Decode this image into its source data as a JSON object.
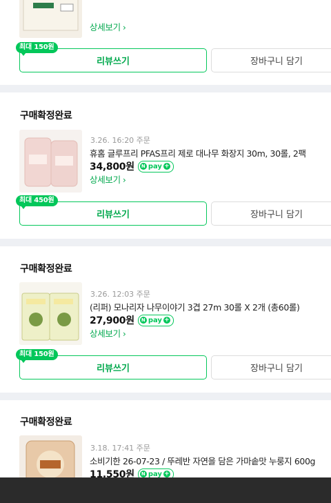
{
  "orders": [
    {
      "status": "",
      "date": "",
      "product": "",
      "price": "",
      "npay_label": "pay",
      "detail_label": "상세보기",
      "reward_badge": "최대 150원",
      "review_label": "리뷰쓰기",
      "cart_label": "장바구니 담기"
    },
    {
      "status": "구매확정완료",
      "date": "3.26. 16:20 주문",
      "product": "휴홈 글루프리 PFAS프리 제로 대나무 화장지 30m, 30롤, 2팩",
      "price": "34,800원",
      "npay_label": "pay",
      "detail_label": "상세보기",
      "reward_badge": "최대 450원",
      "review_label": "리뷰쓰기",
      "cart_label": "장바구니 담기"
    },
    {
      "status": "구매확정완료",
      "date": "3.26. 12:03 주문",
      "product": "(리퍼) 모나리자 나무이야기 3겹 27m 30롤 X 2개 (총60롤)",
      "price": "27,900원",
      "npay_label": "pay",
      "detail_label": "상세보기",
      "reward_badge": "최대 150원",
      "review_label": "리뷰쓰기",
      "cart_label": "장바구니 담기"
    },
    {
      "status": "구매확정완료",
      "date": "3.18. 17:41 주문",
      "product": "소비기한 26-07-23 / 뚜레반 자연을 담은 가마솥맛 누룽지 600g",
      "price": "11,550원",
      "npay_label": "pay",
      "detail_label": "",
      "reward_badge": "",
      "review_label": "",
      "cart_label": ""
    }
  ],
  "colors": {
    "accent_green": "#03c75a",
    "page_bg": "#eef0f4",
    "bottom_bar": "#2b2b2b"
  }
}
